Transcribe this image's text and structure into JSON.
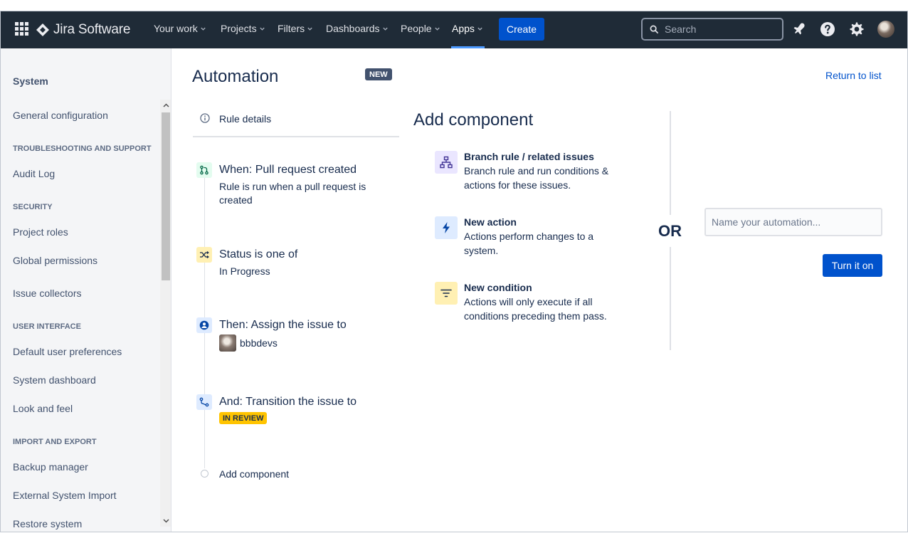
{
  "topnav": {
    "brand": "Jira Software",
    "items": [
      {
        "label": "Your work"
      },
      {
        "label": "Projects"
      },
      {
        "label": "Filters"
      },
      {
        "label": "Dashboards"
      },
      {
        "label": "People"
      },
      {
        "label": "Apps"
      }
    ],
    "active_item": "Apps",
    "create_label": "Create",
    "search_placeholder": "Search",
    "icons": [
      "apps-grid-icon",
      "jira-logo-icon",
      "chevron-down-icon",
      "search-icon",
      "notification-icon",
      "help-icon",
      "settings-icon",
      "avatar"
    ]
  },
  "sidebar": {
    "title": "System",
    "general": "General configuration",
    "sections": {
      "troubleshooting": "TROUBLESHOOTING AND SUPPORT",
      "security": "SECURITY",
      "user_interface": "USER INTERFACE",
      "import_export": "IMPORT AND EXPORT"
    },
    "items": {
      "audit_log": "Audit Log",
      "project_roles": "Project roles",
      "global_permissions": "Global permissions",
      "issue_collectors": "Issue collectors",
      "default_user_prefs": "Default user preferences",
      "system_dashboard": "System dashboard",
      "look_and_feel": "Look and feel",
      "backup_manager": "Backup manager",
      "external_import": "External System Import",
      "restore_system": "Restore system"
    }
  },
  "main": {
    "title": "Automation",
    "badge": "NEW",
    "return_link": "Return to list",
    "rule_details": "Rule details",
    "steps": {
      "trigger": {
        "title": "When: Pull request created",
        "desc": "Rule is run when a pull request is created"
      },
      "condition": {
        "title": "Status is one of",
        "desc": "In Progress"
      },
      "assign": {
        "title": "Then: Assign the issue to",
        "user": "bbbdevs"
      },
      "transition": {
        "title": "And: Transition the issue to",
        "status": "IN REVIEW"
      },
      "add": {
        "label": "Add component"
      }
    }
  },
  "add_component": {
    "title": "Add component",
    "options": {
      "branch": {
        "title": "Branch rule / related issues",
        "desc": "Branch rule and run conditions & actions for these issues."
      },
      "action": {
        "title": "New action",
        "desc": "Actions perform changes to a system."
      },
      "condition": {
        "title": "New condition",
        "desc": "Actions will only execute if all conditions preceding them pass."
      }
    }
  },
  "quick_create": {
    "or_label": "OR",
    "name_placeholder": "Name your automation...",
    "turn_on_label": "Turn it on"
  },
  "colors": {
    "nav_bg": "#1f2b37",
    "primary": "#0052cc",
    "status_yellow": "#ffc400",
    "trigger_green": "#e3fcef",
    "condition_yellow": "#fff0b3",
    "action_blue": "#deebff",
    "branch_purple": "#eae6ff"
  }
}
